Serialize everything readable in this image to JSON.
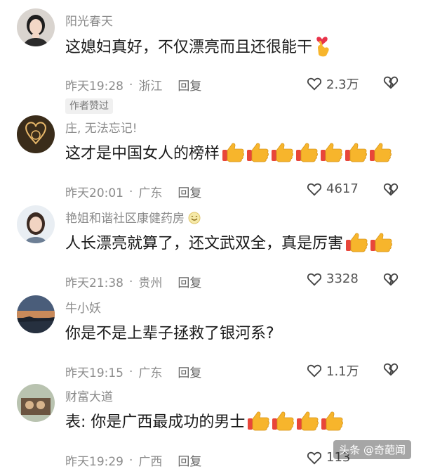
{
  "comments": [
    {
      "username": "阳光春天",
      "text": "这媳妇真好，不仅漂亮而且还很能干",
      "time": "昨天19:28",
      "location": "浙江",
      "reply_label": "回复",
      "likes": "2.3万",
      "badge": "作者赞过",
      "emoji": "hand-heart-emoji"
    },
    {
      "username": "庄, 无法忘记!",
      "text": "这才是中国女人的榜样",
      "time": "昨天20:01",
      "location": "广东",
      "reply_label": "回复",
      "likes": "4617",
      "emoji": "thumbs-up-emoji",
      "emoji_count": 7
    },
    {
      "username": "艳姐和谐社区康健药房",
      "text": "人长漂亮就算了，还文武双全，真是厉害",
      "time": "昨天21:38",
      "location": "贵州",
      "reply_label": "回复",
      "likes": "3328",
      "emoji": "thumbs-up-emoji",
      "emoji_count": 2
    },
    {
      "username": "牛小妖",
      "text": "你是不是上辈子拯救了银河系?",
      "time": "昨天19:15",
      "location": "广东",
      "reply_label": "回复",
      "likes": "1.1万"
    },
    {
      "username": "财富大道",
      "text": "表: 你是广西最成功的男士",
      "time": "昨天19:29",
      "location": "广西",
      "reply_label": "回复",
      "likes": "113",
      "emoji": "thumbs-up-emoji",
      "emoji_count": 4
    }
  ],
  "separator": "·",
  "watermark": "头条 @奇葩闻",
  "colors": {
    "text": "#1a1a1a",
    "meta": "#8d8d8d",
    "thumb": "#f7b52c",
    "thumb_cuff": "#e8463a"
  }
}
